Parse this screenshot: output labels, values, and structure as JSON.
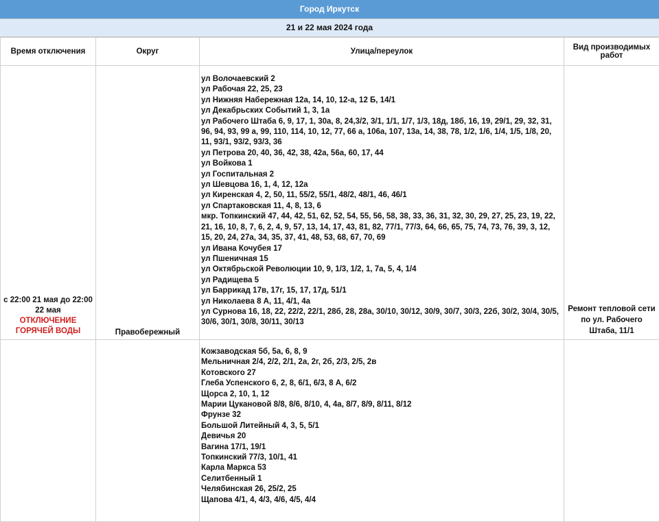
{
  "header": {
    "city": "Город Иркутск",
    "dates": "21 и 22 мая 2024 года"
  },
  "columns": {
    "time": "Время отключения",
    "district": "Округ",
    "street": "Улица/переулок",
    "work": "Вид производимых работ"
  },
  "rows": [
    {
      "time": "с 22:00 21 мая до 22:00 22 мая",
      "alert": "ОТКЛЮЧЕНИЕ ГОРЯЧЕЙ ВОДЫ",
      "district": "Правобережный",
      "work": "Ремонт тепловой сети по ул. Рабочего Штаба, 11/1",
      "streets": [
        "ул Волочаевский 2",
        "ул Рабочая 22, 25, 23",
        "ул Нижняя Набережная 12а, 14, 10, 12-а, 12 Б, 14/1",
        "ул Декабрьских Событий 1, 3, 1а",
        "ул Рабочего Штаба 6, 9, 17, 1, 30а, 8, 24,3/2, 3/1, 1/1, 1/7, 1/3, 18д, 18б, 16, 19, 29/1, 29, 32, 31, 96, 94, 93, 99 а, 99, 110, 114, 10, 12, 77, 66 а, 106а, 107, 13а, 14, 38, 78, 1/2, 1/6, 1/4, 1/5, 1/8, 20, 11, 93/1, 93/2, 93/3, 36",
        "ул Петрова 20, 40, 36, 42, 38, 42а, 56а, 60, 17, 44",
        "ул Войкова 1",
        "ул Госпитальная 2",
        "ул Шевцова 16, 1, 4, 12, 12а",
        "ул Киренская 4, 2, 50, 11, 55/2, 55/1, 48/2, 48/1, 46, 46/1",
        "ул Спартаковская 11, 4, 8, 13, 6",
        "мкр. Топкинский 47, 44, 42, 51, 62, 52, 54, 55, 56, 58, 38, 33, 36, 31, 32, 30, 29, 27, 25, 23, 19, 22, 21, 16, 10, 8, 7, 6, 2, 4, 9, 57, 13, 14, 17, 43, 81, 82, 77/1, 77/3, 64, 66, 65, 75, 74, 73, 76, 39, 3, 12, 15, 20, 24, 27а, 34, 35, 37, 41, 48, 53, 68, 67, 70, 69",
        "ул Ивана Кочубея 17",
        "ул Пшеничная 15",
        "ул Октябрьской Революции 10, 9, 1/3, 1/2, 1, 7а, 5, 4, 1/4",
        "ул Радищева 5",
        "ул Баррикад 17в, 17г, 15, 17, 17д, 51/1",
        "ул Николаева 8 А, 11, 4/1, 4а",
        "ул Сурнова 16, 18, 22, 22/2, 22/1, 28б, 28, 28а, 30/10, 30/12, 30/9, 30/7, 30/3, 22б, 30/2, 30/4, 30/5, 30/6, 30/1, 30/8, 30/11, 30/13"
      ]
    },
    {
      "streets": [
        "Кожзаводская 5б, 5а, 6, 8, 9",
        "Мельничная 2/4, 2/2, 2/1, 2а, 2г, 2б, 2/3, 2/5, 2в",
        "Котовского 27",
        "Глеба Успенского 6, 2, 8, 6/1, 6/3, 8 А, 6/2",
        "Щорса 2, 10, 1, 12",
        "Марии Цукановой 8/8, 8/6, 8/10, 4, 4а, 8/7, 8/9, 8/11, 8/12",
        "Фрунзе 32",
        "Большой Литейный 4, 3, 5, 5/1",
        "Девичья 20",
        "Вагина 17/1, 19/1",
        "Топкинский 77/3, 10/1, 41",
        "Карла Маркса 53",
        "Селитбенный 1",
        "Челябинская 26, 25/2, 25",
        "Щапова 4/1, 4, 4/3, 4/6, 4/5, 4/4"
      ]
    }
  ]
}
